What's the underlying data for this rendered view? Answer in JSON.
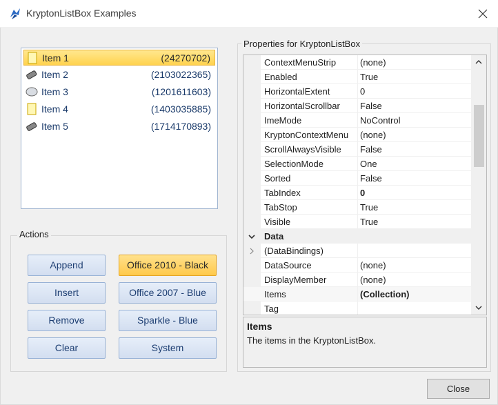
{
  "window": {
    "title": "KryptonListBox Examples"
  },
  "listbox": {
    "items": [
      {
        "label": "Item 1",
        "value": "(24270702)",
        "icon": "note-icon",
        "selected": true
      },
      {
        "label": "Item 2",
        "value": "(2103022365)",
        "icon": "mobile-phone-icon"
      },
      {
        "label": "Item 3",
        "value": "(1201611603)",
        "icon": "cloud-icon"
      },
      {
        "label": "Item 4",
        "value": "(1403035885)",
        "icon": "note-icon"
      },
      {
        "label": "Item 5",
        "value": "(1714170893)",
        "icon": "mobile-phone-icon"
      }
    ]
  },
  "actions": {
    "title": "Actions",
    "append": "Append",
    "insert": "Insert",
    "remove": "Remove",
    "clear": "Clear",
    "office2010black": "Office 2010 - Black",
    "office2007blue": "Office 2007 - Blue",
    "sparkleblue": "Sparkle - Blue",
    "system": "System"
  },
  "properties": {
    "title": "Properties for KryptonListBox",
    "rows": [
      {
        "name": "ContextMenuStrip",
        "value": "(none)"
      },
      {
        "name": "Enabled",
        "value": "True"
      },
      {
        "name": "HorizontalExtent",
        "value": "0"
      },
      {
        "name": "HorizontalScrollbar",
        "value": "False"
      },
      {
        "name": "ImeMode",
        "value": "NoControl"
      },
      {
        "name": "KryptonContextMenu",
        "value": "(none)"
      },
      {
        "name": "ScrollAlwaysVisible",
        "value": "False"
      },
      {
        "name": "SelectionMode",
        "value": "One"
      },
      {
        "name": "Sorted",
        "value": "False"
      },
      {
        "name": "TabIndex",
        "value": "0"
      },
      {
        "name": "TabStop",
        "value": "True"
      },
      {
        "name": "Visible",
        "value": "True"
      },
      {
        "name": "Data",
        "value": ""
      },
      {
        "name": "(DataBindings)",
        "value": ""
      },
      {
        "name": "DataSource",
        "value": "(none)"
      },
      {
        "name": "DisplayMember",
        "value": "(none)"
      },
      {
        "name": "Items",
        "value": "(Collection)"
      },
      {
        "name": "Tag",
        "value": ""
      }
    ],
    "description_title": "Items",
    "description_text": "The items in the KryptonListBox."
  },
  "close_label": "Close",
  "colors": {
    "selected_item": "#ffd34e",
    "accent_blue": "#1d3e72"
  }
}
